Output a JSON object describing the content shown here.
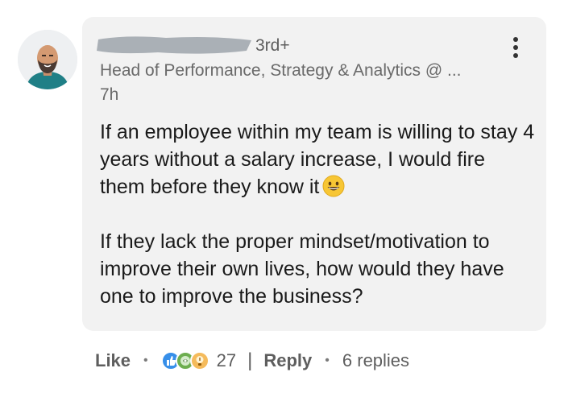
{
  "comment": {
    "author_degree": "3rd+",
    "headline": "Head of Performance, Strategy & Analytics @ ...",
    "time_ago": "7h",
    "paragraphs": [
      "If an employee within my team is willing to stay 4 years without a salary increase, I would fire them before they know it",
      "If they lack the proper mindset/motivation to improve their own lives, how would they have one to improve the business?"
    ],
    "emoji_icon": "grinning-face-icon",
    "more_icon": "more-vertical-icon"
  },
  "actions": {
    "like_label": "Like",
    "reaction_icons": [
      "like-icon",
      "celebrate-icon",
      "insightful-icon"
    ],
    "reaction_count": "27",
    "separator": "|",
    "reply_label": "Reply",
    "replies_label": "6 replies"
  },
  "colors": {
    "bubble_bg": "#f2f2f2",
    "like_blue": "#378fe9",
    "celebrate_green": "#44712e",
    "insightful_yellow": "#f5bb5c"
  }
}
